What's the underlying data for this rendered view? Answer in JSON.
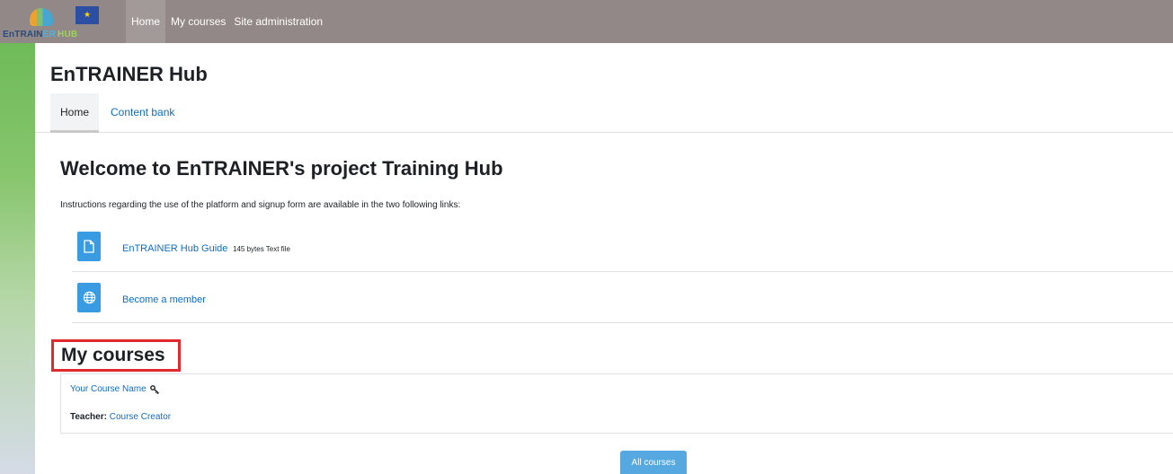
{
  "brand": {
    "wordmark_part1": "EnTRAIN",
    "wordmark_part2": "ER",
    "wordmark_part3": "HUB",
    "eu_flag_stars": "★"
  },
  "navbar": {
    "items": [
      {
        "label": "Home",
        "active": true
      },
      {
        "label": "My courses",
        "active": false
      },
      {
        "label": "Site administration",
        "active": false
      }
    ]
  },
  "page": {
    "heading": "EnTRAINER Hub"
  },
  "secondary_nav": {
    "tabs": [
      {
        "label": "Home",
        "active": true
      },
      {
        "label": "Content bank",
        "active": false
      }
    ]
  },
  "main": {
    "welcome_title": "Welcome to EnTRAINER's project Training Hub",
    "instructions": "Instructions regarding the use of the platform and signup form are available in the two following links:",
    "activities": [
      {
        "label": "EnTRAINER Hub Guide",
        "meta": "145 bytes Text file",
        "icon": "file-icon"
      },
      {
        "label": "Become a member",
        "meta": "",
        "icon": "globe-icon"
      }
    ]
  },
  "my_courses": {
    "heading": "My courses",
    "courses": [
      {
        "name": "Your Course Name",
        "teacher_label": "Teacher:",
        "teacher_name": "Course Creator"
      }
    ],
    "all_courses_button": "All courses"
  },
  "colors": {
    "navbar_bg": "#928887",
    "link": "#0f6cbf",
    "activity_icon_bg": "#399be2",
    "highlight_box": "#e02a2f",
    "button_bg": "#56a9e0"
  }
}
